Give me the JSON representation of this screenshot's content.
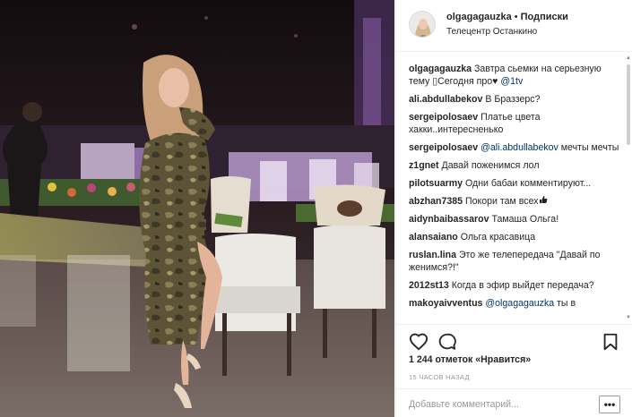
{
  "post": {
    "username": "olgagagauzka",
    "separator": "•",
    "follow_status": "Подписки",
    "location": "Телецентр Останкино"
  },
  "comments": [
    {
      "user": "olgagagauzka",
      "text": "Завтра сьемки на серьезную тему ▯Сегодня про♥ ",
      "mention": "@1tv"
    },
    {
      "user": "ali.abdullabekov",
      "text": "В Браззерс?",
      "mention": ""
    },
    {
      "user": "sergeipolosaev",
      "text": "Платье цвета хакки..интересненько",
      "mention": ""
    },
    {
      "user": "sergeipolosaev",
      "mention": "@ali.abdullabekov",
      "text": " мечты мечты"
    },
    {
      "user": "z1gnet",
      "text": "Давай поженимся лол",
      "mention": ""
    },
    {
      "user": "pilotsuarmy",
      "text": "Одни бабаи комментируют...",
      "mention": ""
    },
    {
      "user": "abzhan7385",
      "text": "Покори там всех",
      "mention": ""
    },
    {
      "user": "aidynbaibassarov",
      "text": "Тамаша Ольга!",
      "mention": ""
    },
    {
      "user": "alansaiano",
      "text": "Ольга красавица",
      "mention": ""
    },
    {
      "user": "ruslan.lina",
      "text": "Это же телепередача \"Давай по женимся?!\"",
      "mention": ""
    },
    {
      "user": "2012st13",
      "text": "Когда в эфир выйдет передача?",
      "mention": ""
    },
    {
      "user": "makoyaivventus",
      "mention": "@olgagagauzka",
      "text": " ты в"
    }
  ],
  "actions": {
    "like_icon": "heart-outline-icon",
    "comment_icon": "speech-bubble-icon",
    "save_icon": "bookmark-icon"
  },
  "likes_text": "1 244 отметок «Нравится»",
  "timestamp": "15 ЧАСОВ НАЗАД",
  "add_comment": {
    "placeholder": "Добавьте комментарий...",
    "value": "",
    "more_label": "•••"
  },
  "colors": {
    "mention": "#003569",
    "divider": "#efefef",
    "muted": "#999999"
  }
}
